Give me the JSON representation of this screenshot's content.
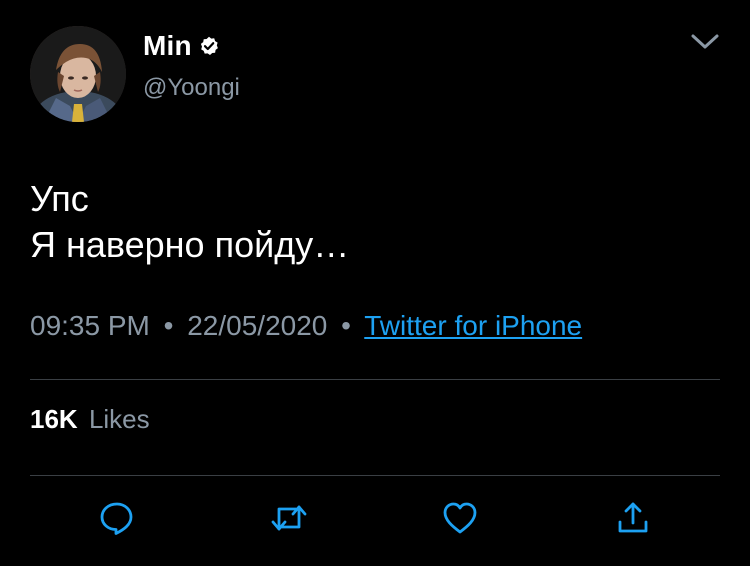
{
  "colors": {
    "background": "#000000",
    "primary_text": "#ffffff",
    "secondary_text": "#8b98a5",
    "link": "#1da1f2",
    "divider": "#3a3f44",
    "icon": "#1da1f2"
  },
  "author": {
    "display_name": "Min",
    "handle": "@Yoongi",
    "verified": true,
    "avatar_icon": "user-avatar-photo"
  },
  "header": {
    "menu_icon": "chevron-down-icon"
  },
  "tweet": {
    "lines": [
      "Упс",
      "Я наверно пойду…"
    ]
  },
  "meta": {
    "time": "09:35 PM",
    "separator": "•",
    "date": "22/05/2020",
    "source": "Twitter for iPhone"
  },
  "stats": {
    "likes_count": "16K",
    "likes_label": "Likes"
  },
  "actions": [
    {
      "name": "reply",
      "icon": "comment-bubble-icon"
    },
    {
      "name": "retweet",
      "icon": "retweet-icon"
    },
    {
      "name": "like",
      "icon": "heart-icon"
    },
    {
      "name": "share",
      "icon": "share-icon"
    }
  ]
}
